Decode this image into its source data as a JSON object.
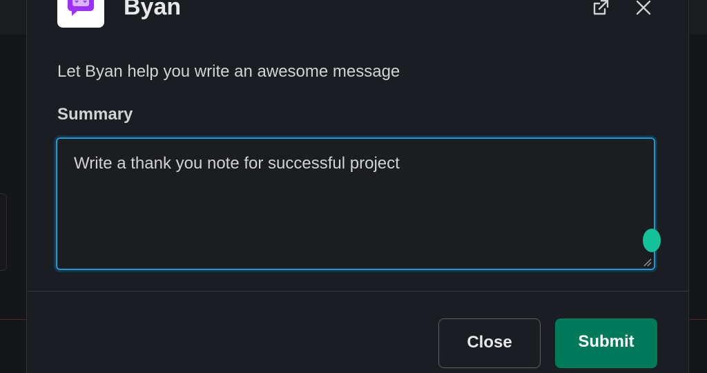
{
  "modal": {
    "app_name": "Byan",
    "intro": "Let Byan help you write an awesome message",
    "summary_label": "Summary",
    "summary_value": "Write a thank you note for successful project",
    "close_label": "Close",
    "submit_label": "Submit"
  },
  "icons": {
    "app": "chat-robot-icon",
    "popout": "external-link-icon",
    "close": "close-icon",
    "resize": "resize-handle-icon"
  },
  "colors": {
    "background": "#1a1d21",
    "focus_border": "#1d9bd1",
    "submit": "#007a5a",
    "app_icon_accent": "#9b30ff",
    "grammar_badge": "#15c39a"
  }
}
